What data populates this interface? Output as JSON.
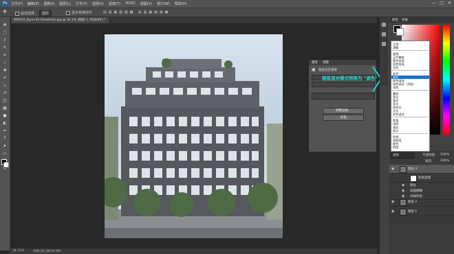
{
  "app": {
    "logo": "Ps"
  },
  "menubar": {
    "items": [
      "文件(F)",
      "编辑(E)",
      "图像(I)",
      "图层(L)",
      "文字(Y)",
      "选择(S)",
      "滤镜(T)",
      "3D(D)",
      "视图(V)",
      "窗口(W)",
      "帮助(H)"
    ],
    "window_buttons": [
      "—",
      "□",
      "✕"
    ]
  },
  "options": {
    "auto_select_label": "自动选择：",
    "auto_select_value": "图层",
    "show_transform_label": "显示变换控件"
  },
  "document": {
    "tab_label": "MARCH_Rynn-01-Sheetlesh.jpg @ 34.1% (图层 1, RGB/8#) *"
  },
  "status": {
    "zoom": "34.11%",
    "doc_info": "文档:10.2M/50.6M"
  },
  "dialog": {
    "tabs": [
      "属性",
      "调整"
    ],
    "title": "图层选区蒙版",
    "btn_refine": "调整边缘...",
    "btn_invert": "反相"
  },
  "annotation": {
    "text": "图层混合模式转换为 \"滤色\""
  },
  "color_panel": {
    "tabs": [
      "颜色",
      "色板"
    ]
  },
  "blend_menu": {
    "options": [
      "正常",
      "溶解",
      "变暗",
      "正片叠底",
      "颜色加深",
      "线性加深",
      "深色",
      "变亮",
      "滤色",
      "颜色减淡",
      "线性减淡（添加）",
      "浅色",
      "叠加",
      "柔光",
      "强光",
      "亮光",
      "线性光",
      "点光",
      "实色混合",
      "差值",
      "排除",
      "减去",
      "划分",
      "色相",
      "饱和度",
      "颜色",
      "明度"
    ],
    "selected": "滤色"
  },
  "layers_panel": {
    "blend_mode": "滤色",
    "opacity_label": "不透明度:",
    "opacity_value": "100%",
    "fill_label": "填充:",
    "fill_value": "100%",
    "rows": [
      {
        "name": "图层 3"
      },
      {
        "name": "智能滤镜"
      },
      {
        "name": "锐化"
      },
      {
        "name": "表面模糊"
      },
      {
        "name": "添加杂色"
      },
      {
        "name": "图层 2"
      },
      {
        "name": "图层 1"
      }
    ]
  }
}
